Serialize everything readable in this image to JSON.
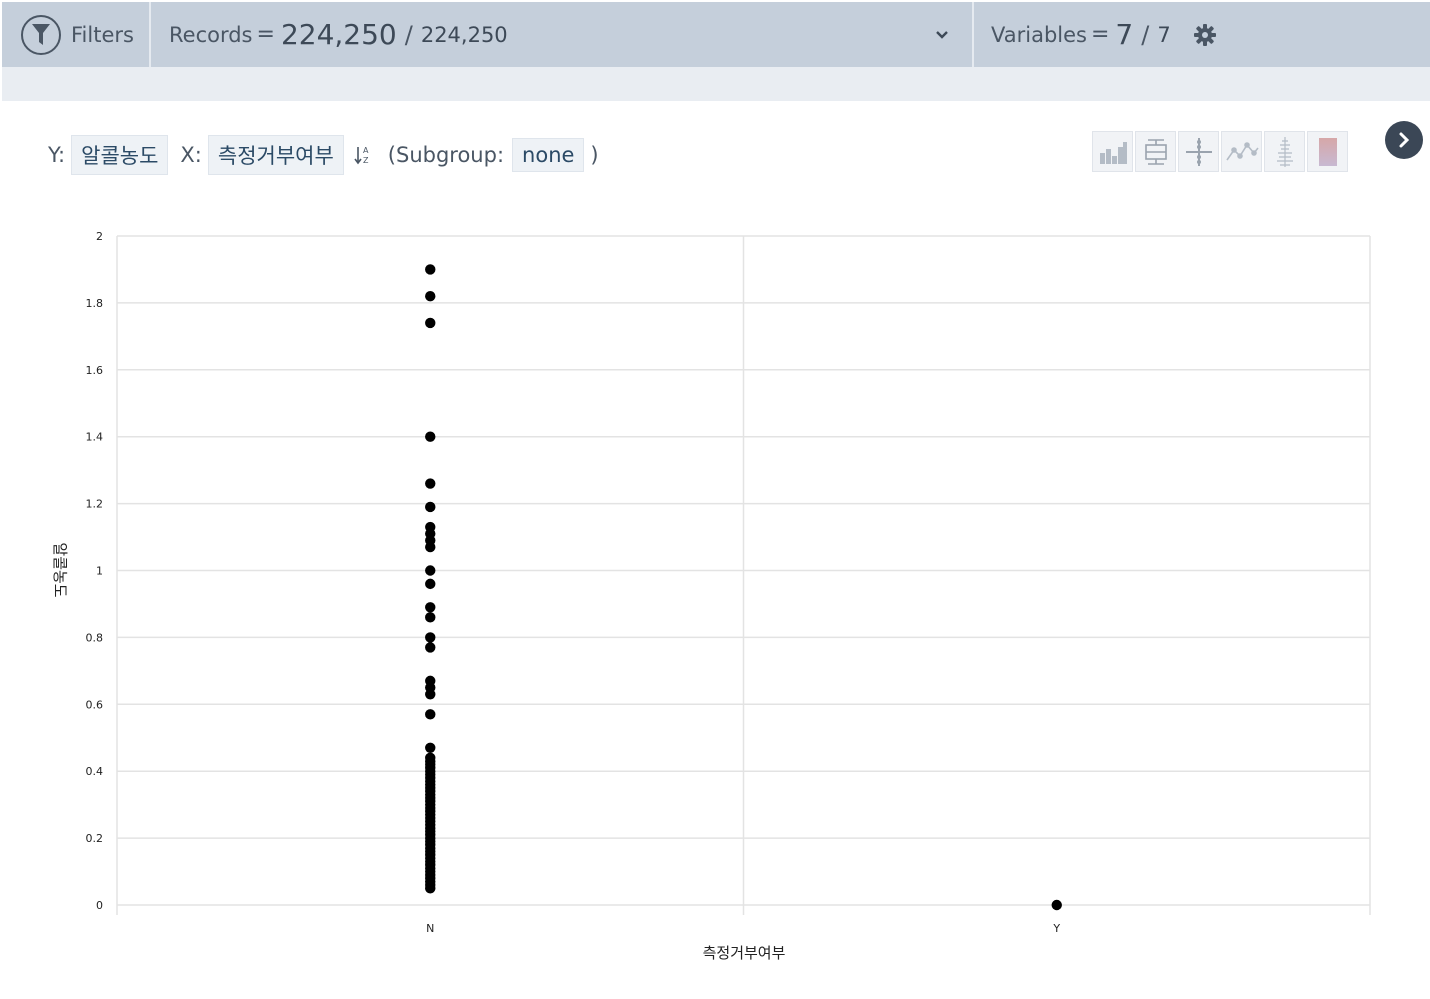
{
  "header": {
    "filters_label": "Filters",
    "records_label": "Records",
    "records_eq": "=",
    "records_count": "224,250",
    "records_slash": "/",
    "records_total": "224,250",
    "variables_label": "Variables",
    "variables_eq": "=",
    "variables_count": "7",
    "variables_slash": "/",
    "variables_total": "7"
  },
  "controls": {
    "y_label": "Y:",
    "y_field": "알콜농도",
    "x_label": "X:",
    "x_field": "측정거부여부",
    "subgroup_prefix": "(Subgroup:",
    "subgroup_value": "none",
    "subgroup_suffix": ")",
    "chart_buttons": [
      "histogram-icon",
      "boxplot-icon",
      "dotplot-icon",
      "lineplot-icon",
      "stripplot-icon",
      "heatmap-icon"
    ]
  },
  "chart_data": {
    "type": "scatter",
    "xlabel": "측정거부여부",
    "ylabel": "알콜농도",
    "categories": [
      "N",
      "Y"
    ],
    "ylim": [
      0,
      2
    ],
    "yticks": [
      "0",
      "0.2",
      "0.4",
      "0.6",
      "0.8",
      "1",
      "1.2",
      "1.4",
      "1.6",
      "1.8",
      "2"
    ],
    "grid": true,
    "point_color": "#000000",
    "points": {
      "N": [
        1.9,
        1.82,
        1.74,
        1.4,
        1.26,
        1.19,
        1.13,
        1.11,
        1.09,
        1.07,
        1.0,
        0.96,
        0.89,
        0.86,
        0.8,
        0.77,
        0.67,
        0.65,
        0.63,
        0.57,
        0.47,
        0.44,
        0.43,
        0.42,
        0.41,
        0.4,
        0.39,
        0.38,
        0.37,
        0.36,
        0.35,
        0.34,
        0.33,
        0.32,
        0.31,
        0.3,
        0.29,
        0.28,
        0.27,
        0.26,
        0.25,
        0.24,
        0.23,
        0.22,
        0.21,
        0.2,
        0.19,
        0.18,
        0.17,
        0.16,
        0.15,
        0.14,
        0.13,
        0.12,
        0.11,
        0.1,
        0.09,
        0.08,
        0.07,
        0.06,
        0.05
      ],
      "Y": [
        0.0
      ]
    }
  }
}
